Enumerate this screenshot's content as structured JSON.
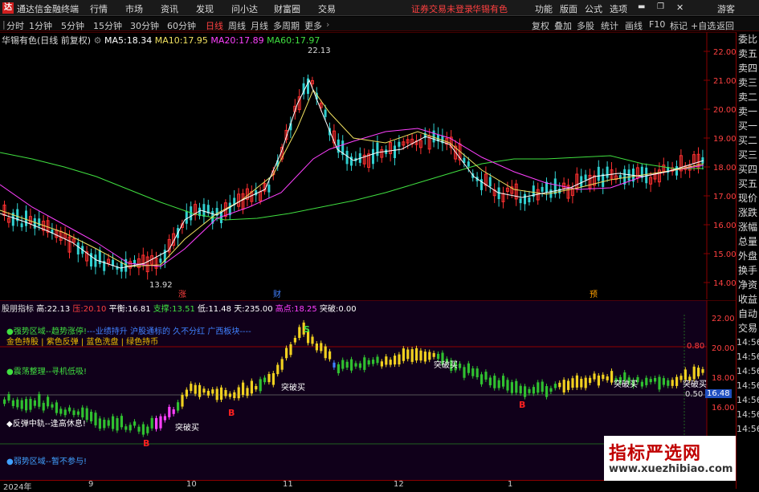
{
  "titlebar": {
    "app_title": "通达信金融终端",
    "menus": [
      "行情",
      "市场",
      "资讯",
      "发现",
      "问小达",
      "财富圈",
      "交易"
    ],
    "notice": "证券交易未登录",
    "stock": "华锡有色",
    "right_menus": [
      "功能",
      "版面",
      "公式",
      "选项"
    ],
    "guest": "游客"
  },
  "toolbar": {
    "periods": [
      "分时",
      "1分钟",
      "5分钟",
      "15分钟",
      "30分钟",
      "60分钟",
      "日线",
      "周线",
      "月线",
      "多周期",
      "更多"
    ],
    "active_period": "日线",
    "right_buttons": [
      "复权",
      "叠加",
      "多股",
      "统计",
      "画线",
      "F10",
      "标记",
      "+自选",
      "返回"
    ]
  },
  "price_chart": {
    "header_name": "华锡有色(日线 前复权)",
    "ma": [
      {
        "label": "MA5:",
        "value": "18.34",
        "color": "#ffffff"
      },
      {
        "label": "MA10:",
        "value": "17.95",
        "color": "#f0e060"
      },
      {
        "label": "MA20:",
        "value": "17.89",
        "color": "#ff40ff"
      },
      {
        "label": "MA60:",
        "value": "17.97",
        "color": "#40e040"
      }
    ],
    "high_label": "22.13",
    "low_label": "13.92",
    "y_ticks": [
      "22.00",
      "21.00",
      "20.00",
      "19.00",
      "18.00",
      "17.00",
      "16.00",
      "15.00",
      "14.00"
    ],
    "markers": [
      {
        "text": "涨",
        "color": "#ff4040"
      },
      {
        "text": "财",
        "color": "#4080ff"
      },
      {
        "text": "预",
        "color": "#ffa000"
      }
    ]
  },
  "indicator": {
    "header": [
      {
        "label": "股朋指标",
        "value": "",
        "color": "#dddddd"
      },
      {
        "label": "高:",
        "value": "22.13",
        "color": "#ffffff"
      },
      {
        "label": "压:",
        "value": "20.10",
        "color": "#ff4040"
      },
      {
        "label": "平衡:",
        "value": "16.81",
        "color": "#ffffff"
      },
      {
        "label": "支撑:",
        "value": "13.51",
        "color": "#40e040"
      },
      {
        "label": "低:",
        "value": "11.48",
        "color": "#ffffff"
      },
      {
        "label": "天:",
        "value": "235.00",
        "color": "#ffffff"
      },
      {
        "label": "高点:",
        "value": "18.25",
        "color": "#ff40ff"
      },
      {
        "label": "突破:",
        "value": "0.00",
        "color": "#ffffff"
      }
    ],
    "zone_strong": "●强势区域--趋势涨停!",
    "news_line": "---业绩持升 沪股通标的 久不分红 广西板块----",
    "legend_line": "金色持股 | 紫色反弹 | 蓝色洗盘 | 绿色持币",
    "zone_consolidate": "●震荡整理--寻机低吸!",
    "zone_rebound": "◆反弹中轨--逢高休息!",
    "zone_weak": "●弱势区域--暂不参与!",
    "breakout_label": "突破买",
    "b_label": "B",
    "s_label": "S",
    "pct_top": "0.80",
    "pct_mid": "0.50",
    "price_box": "16.48",
    "y_ticks": [
      "22.00",
      "20.00",
      "18.00",
      "16.00"
    ]
  },
  "right_panel": [
    "委比",
    "卖五",
    "卖四",
    "卖三",
    "卖二",
    "卖一",
    "买一",
    "买二",
    "买三",
    "买四",
    "买五",
    "现价",
    "涨跌",
    "涨幅",
    "总量",
    "外盘",
    "换手",
    "净资",
    "收益",
    "自动",
    "交易",
    "14:56",
    "14:56",
    "14:56",
    "14:56",
    "14:56",
    "14:56",
    "14:56"
  ],
  "time_axis": [
    "2024年",
    "9",
    "10",
    "11",
    "12",
    "1"
  ],
  "watermark": {
    "big": "指标严选网",
    "small": "www.xuezhibiao.com"
  }
}
